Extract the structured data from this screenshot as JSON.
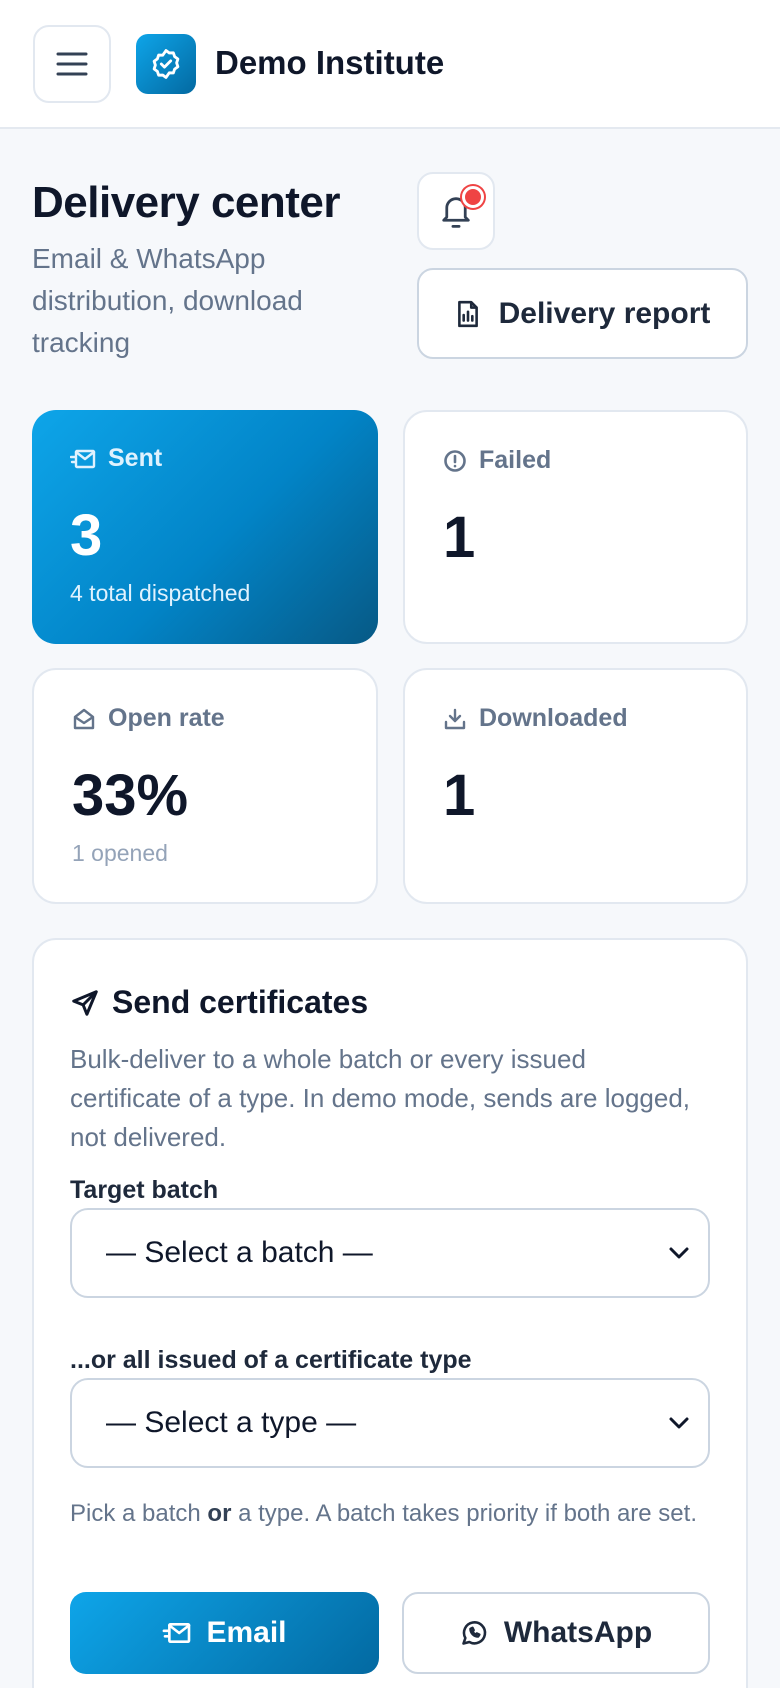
{
  "header": {
    "brand": "Demo Institute",
    "menu_icon": "hamburger-icon",
    "logo_icon": "badge-check-icon"
  },
  "page": {
    "title": "Delivery center",
    "subtitle": "Email & WhatsApp distribution, download tracking",
    "notification_icon": "bell-icon",
    "report_button": "Delivery report"
  },
  "stats": {
    "sent": {
      "label": "Sent",
      "value": "3",
      "note": "4 total dispatched"
    },
    "failed": {
      "label": "Failed",
      "value": "1"
    },
    "open_rate": {
      "label": "Open rate",
      "value": "33%",
      "note": "1 opened"
    },
    "downloaded": {
      "label": "Downloaded",
      "value": "1"
    }
  },
  "send": {
    "title": "Send certificates",
    "description": "Bulk-deliver to a whole batch or every issued certificate of a type. In demo mode, sends are logged, not delivered.",
    "batch_label": "Target batch",
    "batch_placeholder": "— Select a batch —",
    "type_label": "...or all issued of a certificate type",
    "type_placeholder": "— Select a type —",
    "hint_before": "Pick a batch ",
    "hint_bold": "or",
    "hint_after": " a type. A batch takes priority if both are set.",
    "email_button": "Email",
    "whatsapp_button": "WhatsApp"
  },
  "colors": {
    "accent": "#0284c7",
    "alert": "#ef4444"
  }
}
